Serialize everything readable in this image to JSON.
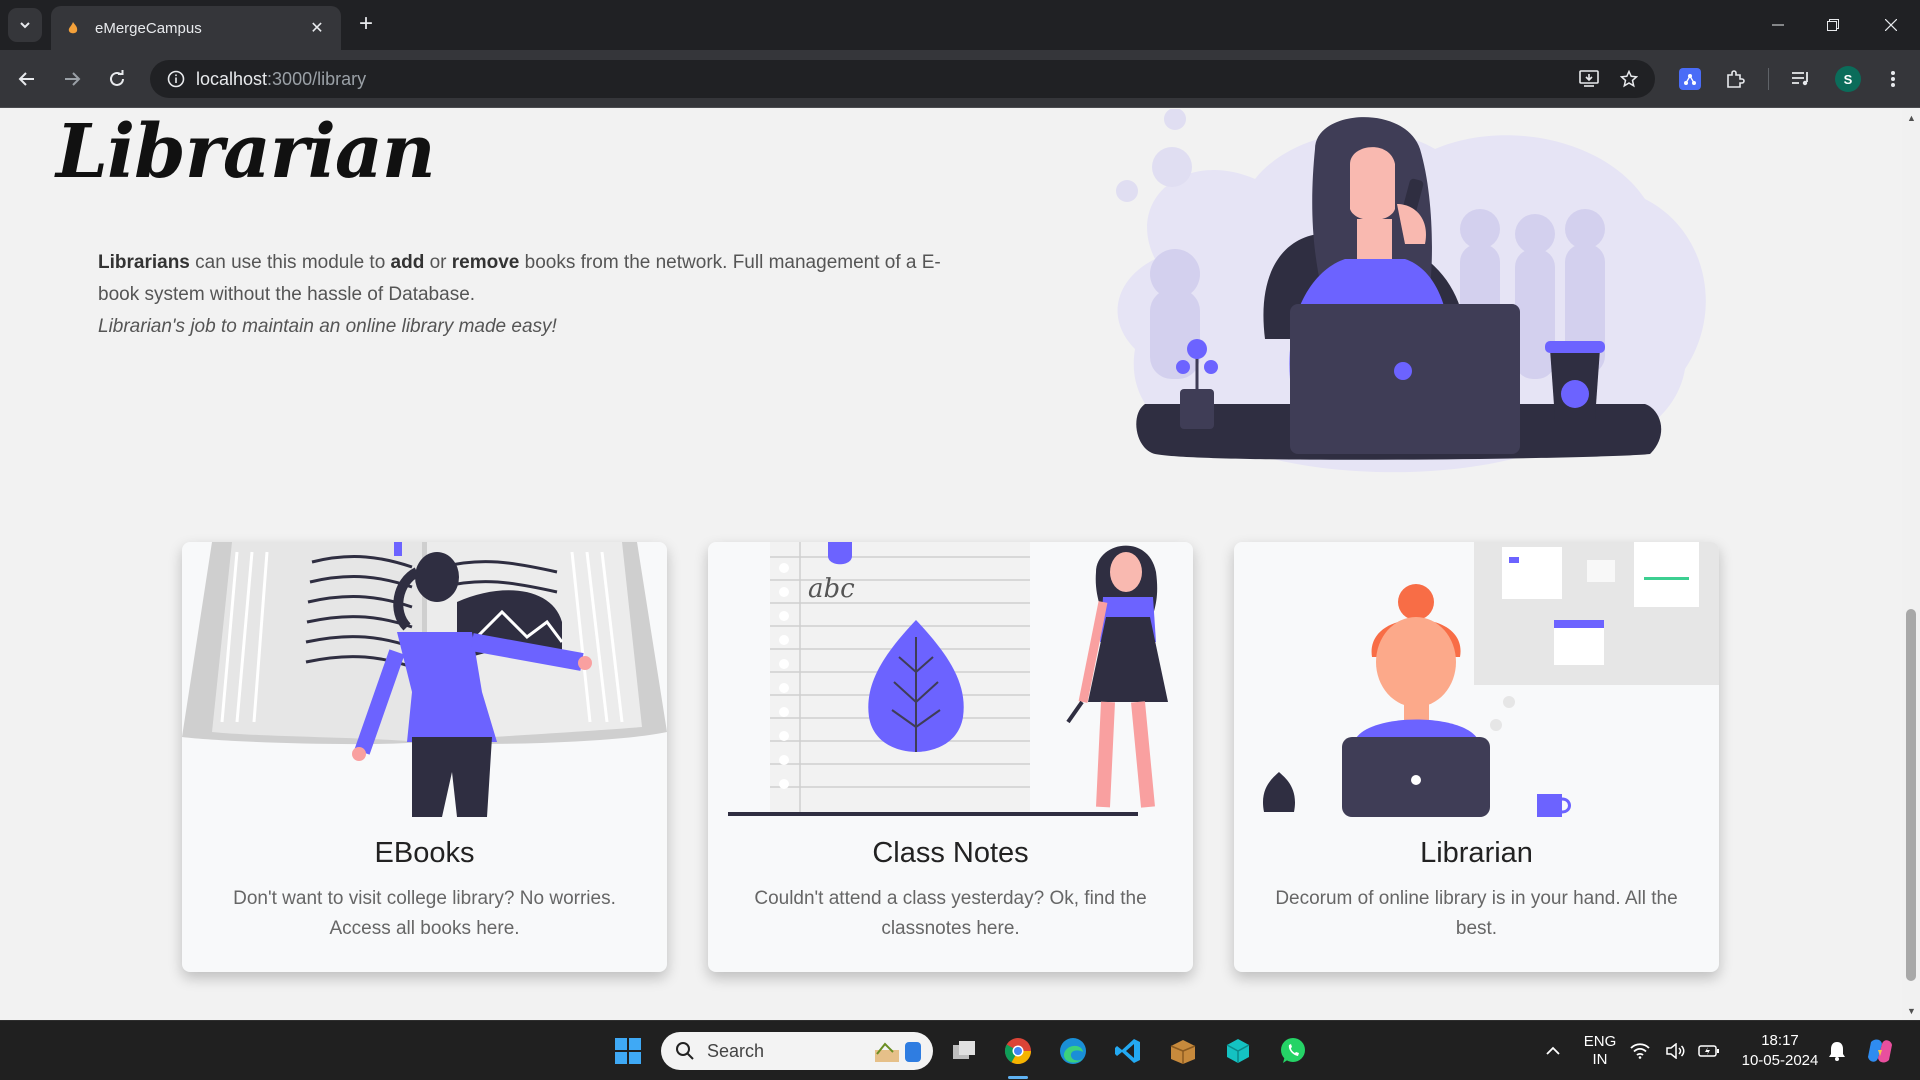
{
  "browser": {
    "tab_title": "eMergeCampus",
    "url_host": "localhost",
    "url_path": ":3000/library",
    "profile_initial": "S"
  },
  "hero": {
    "title": "Librarian",
    "desc_1": "Librarians",
    "desc_2": " can use this module to ",
    "desc_3": "add",
    "desc_4": " or ",
    "desc_5": "remove",
    "desc_6": " books from the network. Full management of a E-book system without the hassle of Database.",
    "tagline": "Librarian's job to maintain an online library made easy!"
  },
  "cards": [
    {
      "title": "EBooks",
      "desc": "Don't want to visit college library? No worries. Access all books here."
    },
    {
      "title": "Class Notes",
      "desc": "Couldn't attend a class yesterday? Ok, find the classnotes here."
    },
    {
      "title": "Librarian",
      "desc": "Decorum of online library is in your hand. All the best."
    }
  ],
  "notes_text": "abc",
  "taskbar": {
    "search_placeholder": "Search",
    "lang_1": "ENG",
    "lang_2": "IN",
    "time": "18:17",
    "date": "10-05-2024"
  },
  "colors": {
    "accent": "#6c63ff",
    "chrome_dark": "#202124",
    "chrome_toolbar": "#35363a"
  }
}
